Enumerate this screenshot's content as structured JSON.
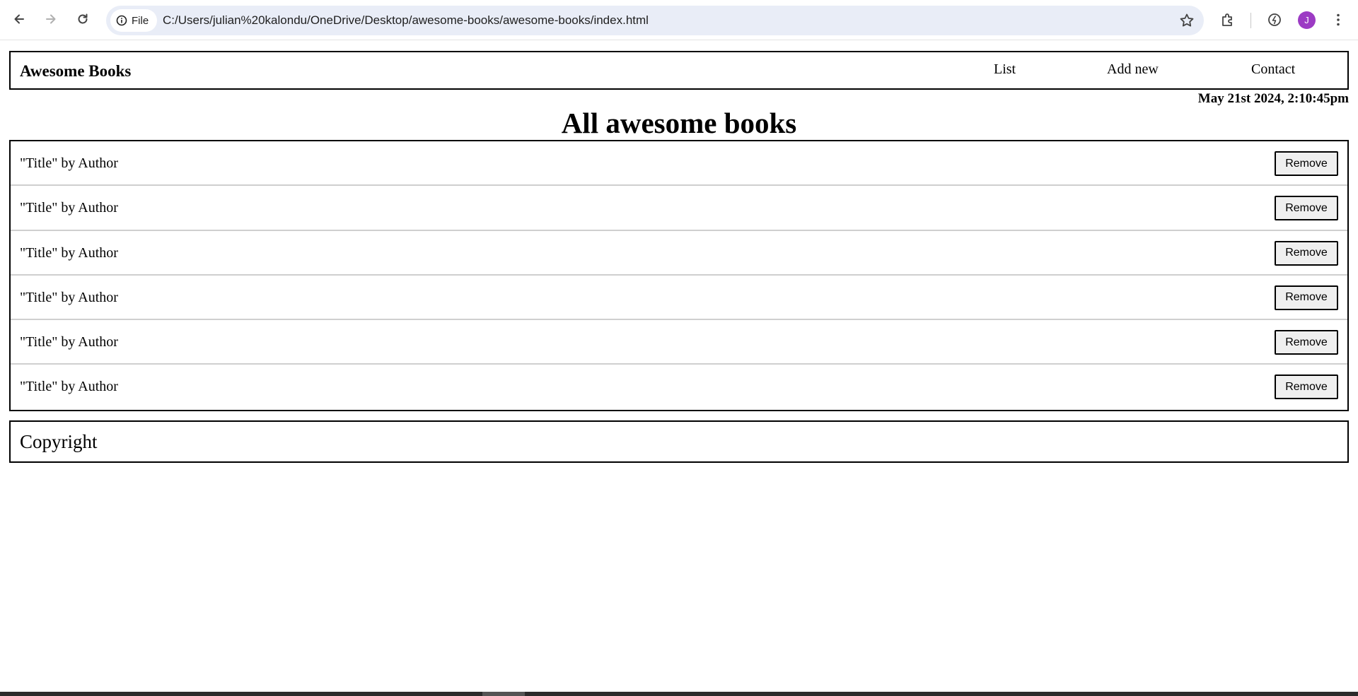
{
  "browser": {
    "site_chip_label": "File",
    "url": "C:/Users/julian%20kalondu/OneDrive/Desktop/awesome-books/awesome-books/index.html",
    "profile_initial": "J",
    "profile_color": "#9c3bc4"
  },
  "header": {
    "logo": "Awesome Books",
    "nav": [
      {
        "label": "List"
      },
      {
        "label": "Add new"
      },
      {
        "label": "Contact"
      }
    ]
  },
  "date_text": "May 21st 2024, 2:10:45pm",
  "main": {
    "title": "All awesome books",
    "books": [
      {
        "text": "\"Title\" by Author",
        "button": "Remove"
      },
      {
        "text": "\"Title\" by Author",
        "button": "Remove"
      },
      {
        "text": "\"Title\" by Author",
        "button": "Remove"
      },
      {
        "text": "\"Title\" by Author",
        "button": "Remove"
      },
      {
        "text": "\"Title\" by Author",
        "button": "Remove"
      },
      {
        "text": "\"Title\" by Author",
        "button": "Remove"
      }
    ]
  },
  "footer": {
    "text": "Copyright"
  },
  "icons": {
    "back": "back-arrow-icon",
    "forward": "forward-arrow-icon",
    "reload": "reload-icon",
    "site_info": "info-icon",
    "bookmark": "star-icon",
    "extensions": "puzzle-icon",
    "performance": "performance-icon",
    "menu": "kebab-menu-icon"
  }
}
